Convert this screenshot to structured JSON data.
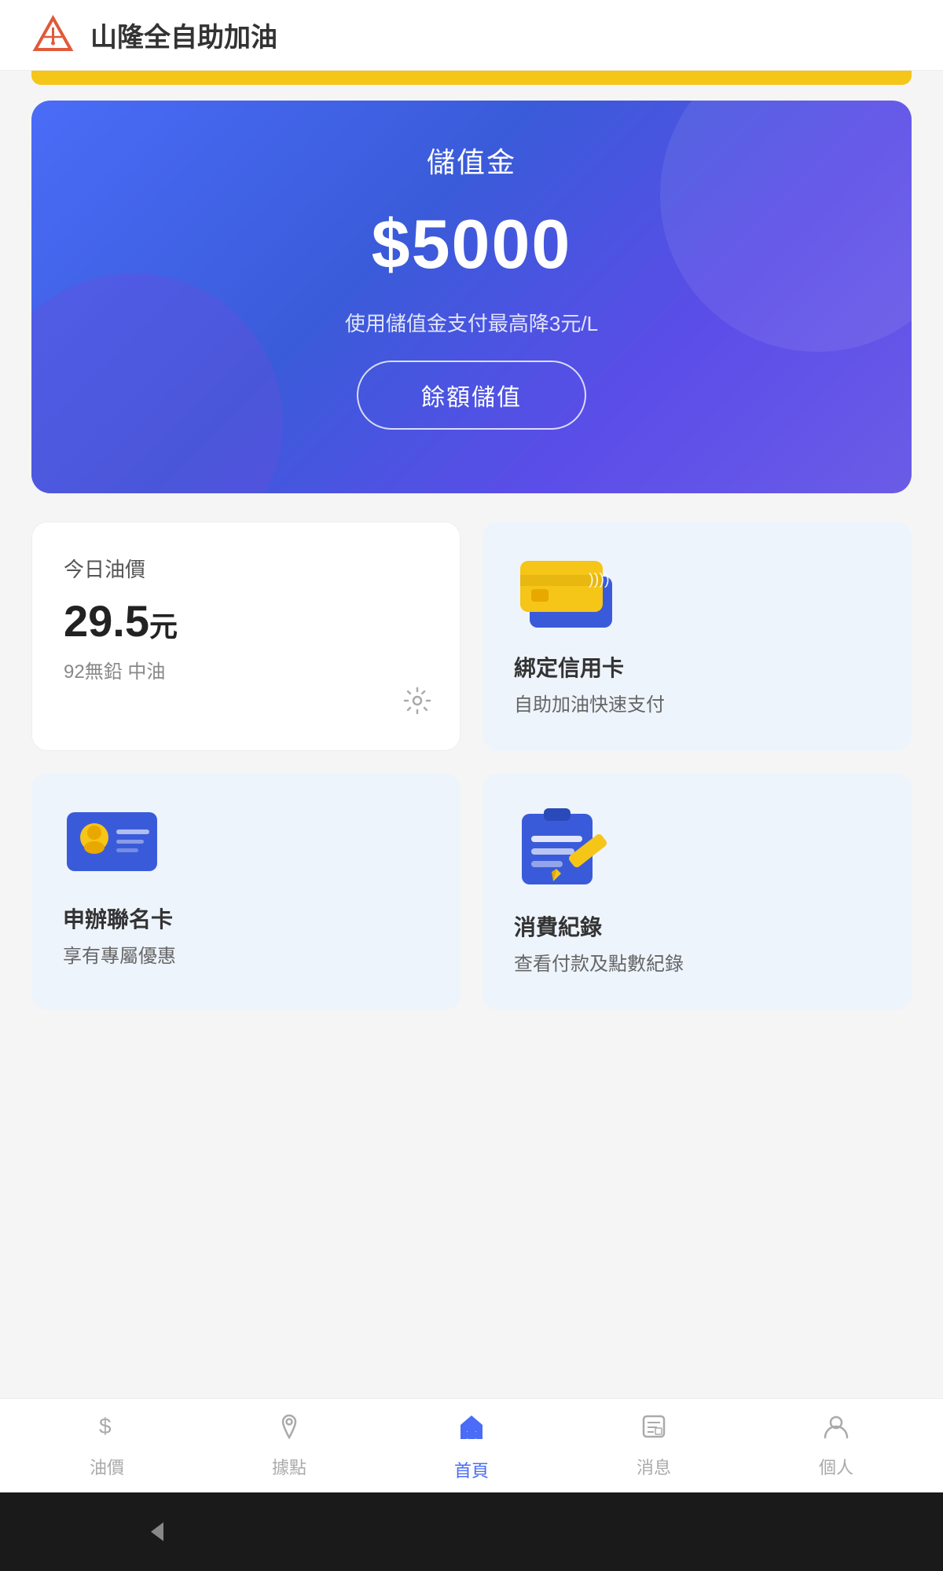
{
  "header": {
    "title": "山隆全自助加油",
    "logo_alt": "山隆 logo"
  },
  "balance_card": {
    "label": "儲值金",
    "amount": "$5000",
    "note": "使用儲值金支付最高降3元/L",
    "button_label": "餘額儲值"
  },
  "oil_price": {
    "section_label": "今日油價",
    "value": "29.5",
    "unit": "元",
    "sub": "92無鉛 中油"
  },
  "credit_card": {
    "title": "綁定信用卡",
    "subtitle": "自助加油快速支付"
  },
  "member_card": {
    "title": "申辦聯名卡",
    "subtitle": "享有專屬優惠"
  },
  "records": {
    "title": "消費紀錄",
    "subtitle": "查看付款及點數紀錄"
  },
  "bottom_nav": {
    "items": [
      {
        "icon": "oil",
        "label": "油價",
        "active": false
      },
      {
        "icon": "location",
        "label": "據點",
        "active": false
      },
      {
        "icon": "home",
        "label": "首頁",
        "active": true
      },
      {
        "icon": "news",
        "label": "消息",
        "active": false
      },
      {
        "icon": "person",
        "label": "個人",
        "active": false
      }
    ]
  },
  "colors": {
    "primary": "#4a6cf7",
    "yellow": "#F5C518",
    "active_nav": "#4a6cf7"
  }
}
